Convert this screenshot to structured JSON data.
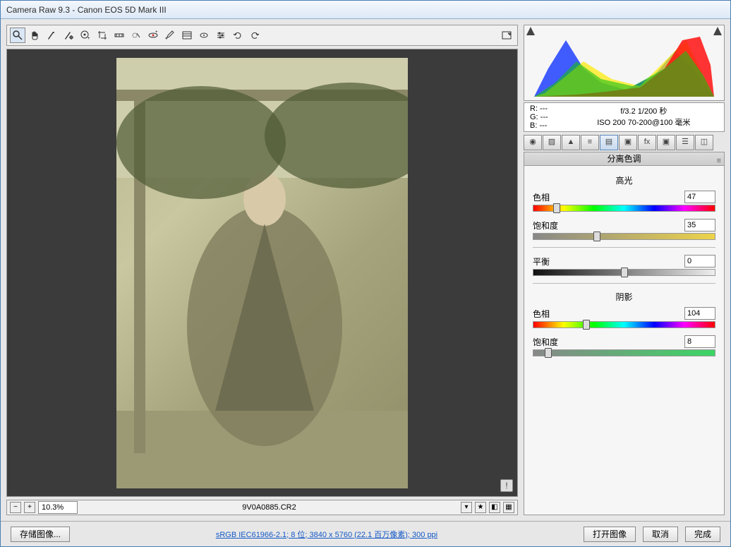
{
  "title": "Camera Raw 9.3  -  Canon EOS 5D Mark III",
  "toolbar": {
    "fullscreen": "⛶"
  },
  "zoom": "10.3%",
  "filename": "9V0A0885.CR2",
  "exif": {
    "r": "R: ---",
    "g": "G: ---",
    "b": "B: ---",
    "line1": "f/3.2  1/200 秒",
    "line2": "ISO 200  70-200@100 毫米"
  },
  "panels": {
    "active": "分离色调",
    "menu": "≡"
  },
  "split": {
    "highlights_title": "高光",
    "shadows_title": "阴影",
    "hue_label": "色相",
    "sat_label": "饱和度",
    "balance_label": "平衡",
    "h_hue": "47",
    "h_sat": "35",
    "balance": "0",
    "s_hue": "104",
    "s_sat": "8"
  },
  "footer": {
    "save": "存储图像...",
    "link": "sRGB IEC61966-2.1; 8 位; 3840 x 5760 (22.1 百万像素); 300 ppi",
    "open": "打开图像",
    "cancel": "取消",
    "done": "完成"
  }
}
